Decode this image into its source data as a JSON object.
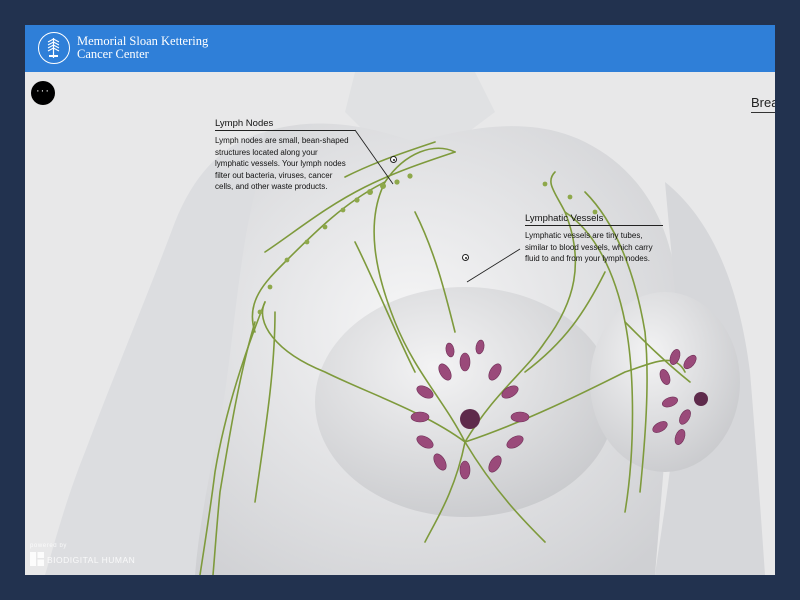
{
  "header": {
    "brand_line1": "Memorial Sloan Kettering",
    "brand_line2": "Cancer Center",
    "logo_icon": "msk-caduceus-icon",
    "bar_color": "#2f7fd8"
  },
  "menu_button": {
    "label": "···",
    "icon": "more-icon"
  },
  "view_title": "Brea",
  "annotations": {
    "lymph_nodes": {
      "title": "Lymph Nodes",
      "body": "Lymph nodes are small, bean-shaped structures located along your lymphatic vessels. Your lymph nodes filter out bacteria, viruses, cancer cells, and other waste products."
    },
    "lymphatic_vessels": {
      "title": "Lymphatic Vessels",
      "body": "Lymphatic vessels are tiny tubes, similar to blood vessels, which carry fluid to and from your lymph nodes."
    }
  },
  "footer": {
    "powered_by": "powered by",
    "product": "BIODIGITAL HUMAN"
  },
  "colors": {
    "page_background": "#22324f",
    "vessel": "#7e9a3c",
    "node": "#9a4a7a"
  }
}
